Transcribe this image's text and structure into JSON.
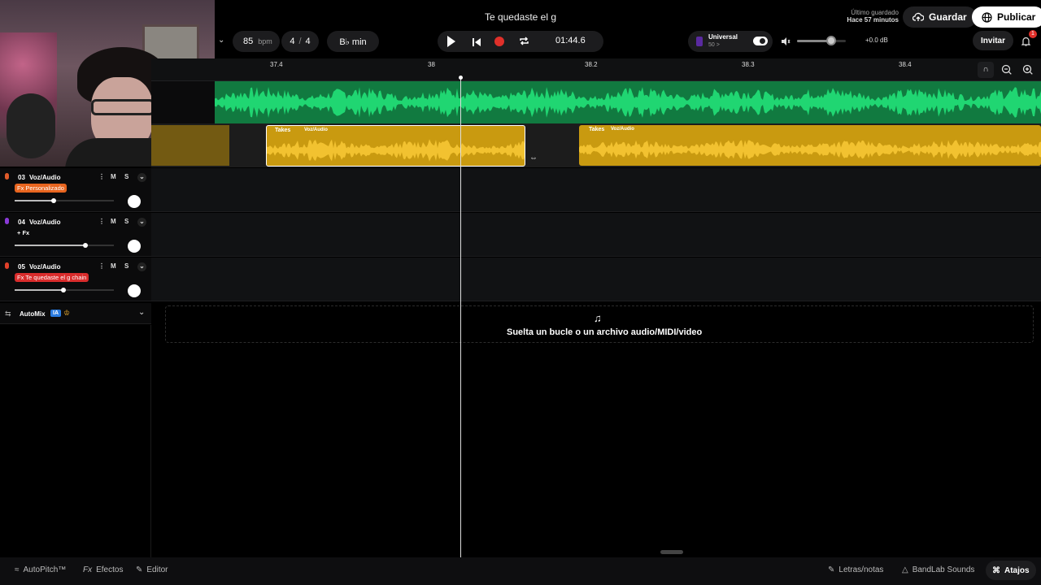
{
  "project_title": "Te quedaste el g",
  "transport": {
    "bpm_value": "85",
    "bpm_unit": "bpm",
    "time_sig_num": "4",
    "time_sig_sep": "/",
    "time_sig_den": "4",
    "key": "B♭ min",
    "time": "01:44.6"
  },
  "save_status": {
    "line1": "Último guardado",
    "line2": "Hace 57 minutos"
  },
  "buttons": {
    "save": "Guardar",
    "publish": "Publicar",
    "invite": "Invitar",
    "notifications_badge": "1"
  },
  "universal": {
    "label": "Universal",
    "sub": "50 >"
  },
  "master_volume": {
    "db": "+0.0 dB",
    "level": 0.7
  },
  "ruler": [
    "37.4",
    "38",
    "38.2",
    "38.3",
    "38.4"
  ],
  "tracks": [
    {
      "number": "03",
      "name": "Voz/Audio",
      "fx": "Fx Personalizado",
      "fx_color": "#e8651f",
      "volume": 0.4,
      "icon_color": "#e05a2a",
      "m": "M",
      "s": "S"
    },
    {
      "number": "04",
      "name": "Voz/Audio",
      "fx": "+ Fx",
      "fx_color": "",
      "volume": 0.72,
      "icon_color": "#8a3ad8",
      "m": "M",
      "s": "S"
    },
    {
      "number": "05",
      "name": "Voz/Audio",
      "fx": "Fx Te quedaste el g chain",
      "fx_color": "#d92c2c",
      "volume": 0.5,
      "icon_color": "#e0402a",
      "m": "M",
      "s": "S"
    }
  ],
  "clips": {
    "clip1_takes": "Takes",
    "clip1_name": "Voz/Audio",
    "clip2_takes": "Takes",
    "clip2_name": "Voz/Audio"
  },
  "automix": {
    "label": "AutoMix",
    "badge": "IA"
  },
  "drop_zone_text": "Suelta un bucle o un archivo audio/MIDI/video",
  "bottom_bar": {
    "autopitch": "AutoPitch™",
    "fx_prefix": "Fx",
    "effects": "Efectos",
    "editor": "Editor",
    "lyrics": "Letras/notas",
    "bandlab_sounds": "BandLab Sounds",
    "shortcuts": "Atajos"
  },
  "colors": {
    "accent_green": "#1fd46f",
    "clip_gold": "#d8a21a",
    "record_red": "#e0302a"
  }
}
